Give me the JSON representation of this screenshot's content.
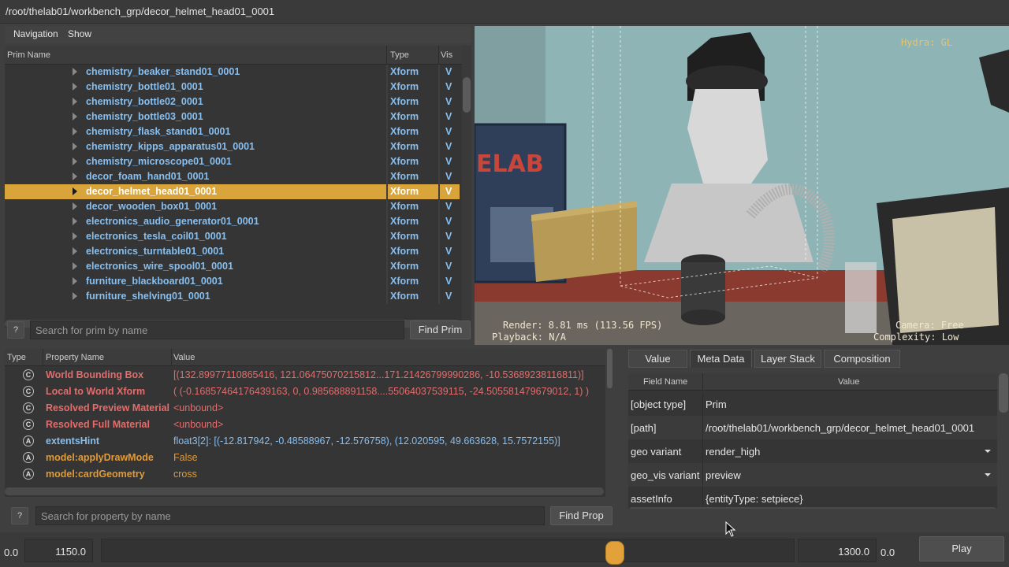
{
  "path_bar": {
    "text": "/root/thelab01/workbench_grp/decor_helmet_head01_0001"
  },
  "menu": {
    "navigation": "Navigation",
    "show": "Show"
  },
  "tree": {
    "headers": {
      "name": "Prim Name",
      "type": "Type",
      "vis": "Vis"
    },
    "rows": [
      {
        "name": "chemistry_beaker_stand01_0001",
        "type": "Xform",
        "vis": "V"
      },
      {
        "name": "chemistry_bottle01_0001",
        "type": "Xform",
        "vis": "V"
      },
      {
        "name": "chemistry_bottle02_0001",
        "type": "Xform",
        "vis": "V"
      },
      {
        "name": "chemistry_bottle03_0001",
        "type": "Xform",
        "vis": "V"
      },
      {
        "name": "chemistry_flask_stand01_0001",
        "type": "Xform",
        "vis": "V"
      },
      {
        "name": "chemistry_kipps_apparatus01_0001",
        "type": "Xform",
        "vis": "V"
      },
      {
        "name": "chemistry_microscope01_0001",
        "type": "Xform",
        "vis": "V"
      },
      {
        "name": "decor_foam_hand01_0001",
        "type": "Xform",
        "vis": "V"
      },
      {
        "name": "decor_helmet_head01_0001",
        "type": "Xform",
        "vis": "V",
        "selected": true
      },
      {
        "name": "decor_wooden_box01_0001",
        "type": "Xform",
        "vis": "V"
      },
      {
        "name": "electronics_audio_generator01_0001",
        "type": "Xform",
        "vis": "V"
      },
      {
        "name": "electronics_tesla_coil01_0001",
        "type": "Xform",
        "vis": "V"
      },
      {
        "name": "electronics_turntable01_0001",
        "type": "Xform",
        "vis": "V"
      },
      {
        "name": "electronics_wire_spool01_0001",
        "type": "Xform",
        "vis": "V"
      },
      {
        "name": "furniture_blackboard01_0001",
        "type": "Xform",
        "vis": "V"
      },
      {
        "name": "furniture_shelving01_0001",
        "type": "Xform",
        "vis": "V"
      }
    ],
    "help_label": "?",
    "search_placeholder": "Search for prim by name",
    "find_button": "Find Prim"
  },
  "viewport": {
    "renderer": "Hydra: GL",
    "render_stats": "Render: 8.81 ms (113.56 FPS)",
    "playback": "Playback: N/A",
    "camera": "Camera: Free",
    "complexity": "Complexity: Low",
    "poster_text": "ELAB"
  },
  "properties": {
    "headers": {
      "type": "Type",
      "name": "Property Name",
      "value": "Value"
    },
    "rows": [
      {
        "icon": "C",
        "name": "World Bounding Box",
        "value": "[(132.89977110865416, 121.06475070215812...171.21426799990286, -10.53689238116811)]",
        "color": "red"
      },
      {
        "icon": "C",
        "name": "Local to World Xform",
        "value": "( (-0.16857464176439163, 0, 0.985688891158....55064037539115, -24.505581479679012, 1) )",
        "color": "red"
      },
      {
        "icon": "C",
        "name": "Resolved Preview Material",
        "value": "<unbound>",
        "color": "red"
      },
      {
        "icon": "C",
        "name": "Resolved Full Material",
        "value": "<unbound>",
        "color": "red"
      },
      {
        "icon": "A",
        "name": "extentsHint",
        "value": "float3[2]: [(-12.817942, -0.48588967, -12.576758), (12.020595, 49.663628, 15.7572155)]",
        "color": "blue"
      },
      {
        "icon": "A",
        "name": "model:applyDrawMode",
        "value": "False",
        "color": "orange"
      },
      {
        "icon": "A",
        "name": "model:cardGeometry",
        "value": "cross",
        "color": "orange"
      }
    ],
    "help_label": "?",
    "search_placeholder": "Search for property by name",
    "find_button": "Find Prop"
  },
  "tabs": [
    "Value",
    "Meta Data",
    "Layer Stack",
    "Composition"
  ],
  "active_tab": "Meta Data",
  "metadata": {
    "headers": {
      "field": "Field Name",
      "value": "Value"
    },
    "rows": [
      {
        "field": "[object type]",
        "value": "Prim"
      },
      {
        "field": "[path]",
        "value": "/root/thelab01/workbench_grp/decor_helmet_head01_0001"
      },
      {
        "field": "geo variant",
        "value": "render_high",
        "dropdown": true
      },
      {
        "field": "geo_vis variant",
        "value": "preview",
        "dropdown": true
      },
      {
        "field": "assetInfo",
        "value": "{entityType: setpiece}"
      }
    ]
  },
  "timeline": {
    "start": "0.0",
    "start_frame": "1150.0",
    "end_frame": "1300.0",
    "end": "0.0",
    "play_button": "Play"
  },
  "colors": {
    "selection": "#d9a53b",
    "prim_name": "#87bff0",
    "computed_prop": "#e36c6c",
    "authored_prop": "#e09a38",
    "hud": "#e8c36a"
  }
}
